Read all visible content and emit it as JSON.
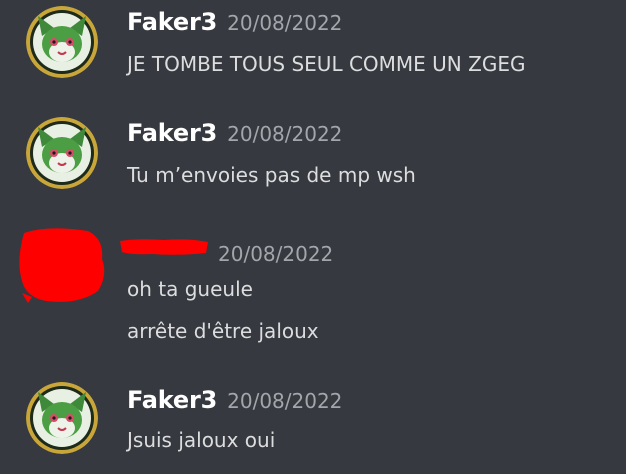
{
  "colors": {
    "background": "#36393f",
    "username": "#ffffff",
    "timestamp": "#a3a6aa",
    "message": "#dcddde",
    "redaction": "#ff0000"
  },
  "messages": [
    {
      "author": "Faker3",
      "timestamp": "20/08/2022",
      "avatar_icon": "cat-avatar-icon",
      "lines": [
        "JE TOMBE TOUS SEUL COMME UN ZGEG"
      ]
    },
    {
      "author": "Faker3",
      "timestamp": "20/08/2022",
      "avatar_icon": "cat-avatar-icon",
      "lines": [
        "Tu m’envoies pas de mp wsh"
      ]
    },
    {
      "author": "",
      "timestamp": "20/08/2022",
      "avatar_icon": "redacted-avatar",
      "lines": [
        "oh ta gueule",
        "arrête d'être jaloux"
      ]
    },
    {
      "author": "Faker3",
      "timestamp": "20/08/2022",
      "avatar_icon": "cat-avatar-icon",
      "lines": [
        "Jsuis jaloux oui"
      ]
    }
  ]
}
